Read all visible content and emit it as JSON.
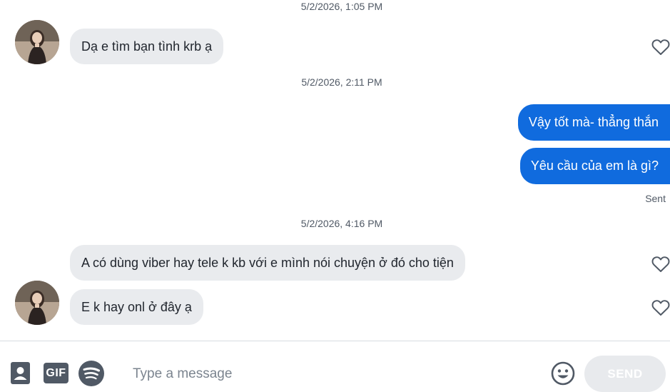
{
  "conversation": {
    "groups": [
      {
        "timestamp": "5/2/2026, 1:05 PM"
      },
      {
        "timestamp": "5/2/2026, 2:11 PM"
      },
      {
        "timestamp": "5/2/2026, 4:16 PM"
      }
    ],
    "messages": [
      {
        "direction": "incoming",
        "text": "Dạ e tìm bạn tình krb ạ"
      },
      {
        "direction": "outgoing",
        "text": "Vậy tốt mà- thẳng thắn"
      },
      {
        "direction": "outgoing",
        "text": "Yêu cầu của em là gì?"
      },
      {
        "direction": "incoming",
        "text": "A có dùng viber hay tele k kb với e mình nói chuyện ở đó cho tiện"
      },
      {
        "direction": "incoming",
        "text": "E k hay onl ở đây ạ"
      }
    ],
    "delivery_status": "Sent"
  },
  "composer": {
    "placeholder": "Type a message",
    "gif_label": "GIF",
    "send_label": "SEND",
    "icons": [
      "contact-card-icon",
      "gif-icon",
      "spotify-icon",
      "emoji-icon"
    ]
  },
  "colors": {
    "outgoing_bubble": "#106bde",
    "incoming_bubble": "#e9ebee",
    "send_disabled": "#e8eaed"
  }
}
